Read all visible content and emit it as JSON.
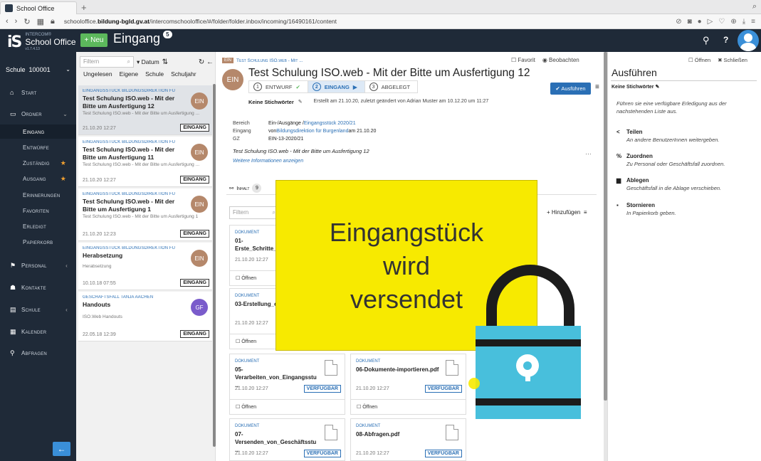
{
  "browser": {
    "tab_title": "School Office",
    "new_tab": "+",
    "url_prefix": "schooloffice.",
    "url_domain": "bildung-bgld.gv.at",
    "url_path": "/intercomschooloffice/#/folder/folder.inbox/incoming/16490161/content"
  },
  "app": {
    "logo_top": "INTERCOM®",
    "logo_name": "School Office",
    "logo_version": "v1.7.4.13",
    "new_button": "+ Neu",
    "title": "Eingang",
    "title_badge": "5",
    "search_icon": "⚲",
    "help": "?"
  },
  "sidebar": {
    "school_label": "Schule",
    "school_number": "100001",
    "items": [
      {
        "icon": "⌂",
        "label": "Start"
      },
      {
        "icon": "▭",
        "label": "Ordner"
      },
      {
        "label": "Eingang"
      },
      {
        "label": "Entwürfe"
      },
      {
        "label": "Zuständig",
        "star": "★"
      },
      {
        "label": "Ausgang",
        "star": "★"
      },
      {
        "label": "Erinnerungen"
      },
      {
        "label": "Favoriten"
      },
      {
        "label": "Erledigt"
      },
      {
        "label": "Papierkorb"
      },
      {
        "icon": "⚑",
        "label": "Personal"
      },
      {
        "icon": "☗",
        "label": "Kontakte"
      },
      {
        "icon": "▤",
        "label": "Schule"
      },
      {
        "icon": "▦",
        "label": "Kalender"
      },
      {
        "icon": "⚲",
        "label": "Abfragen"
      }
    ],
    "back_icon": "←"
  },
  "list": {
    "filter_placeholder": "Filtern",
    "sort": "▾ Datum",
    "filters": [
      "Ungelesen",
      "Eigene",
      "Schule",
      "Schuljahr"
    ],
    "cards": [
      {
        "cat": "Eingangsstück Bildungsdirektion für Bur...",
        "title": "Test Schulung ISO.web - Mit der Bitte um Ausfertigung 12",
        "desc": "Test Schulung ISO.web - Mit der Bitte um Ausfertigung ...",
        "date": "21.10.20 12:27",
        "tag": "EINGANG",
        "avatar": "EIN"
      },
      {
        "cat": "Eingangsstück Bildungsdirektion für Bur...",
        "title": "Test Schulung ISO.web - Mit der Bitte um Ausfertigung 11",
        "desc": "Test Schulung ISO.web - Mit der Bitte um Ausfertigung ...",
        "date": "21.10.20 12:27",
        "tag": "EINGANG",
        "avatar": "EIN"
      },
      {
        "cat": "Eingangsstück Bildungsdirektion für Bur...",
        "title": "Test Schulung ISO.web - Mit der Bitte um Ausfertigung 1",
        "desc": "Test Schulung ISO.web - Mit der Bitte um Ausfertigung 1",
        "date": "21.10.20 12:23",
        "tag": "EINGANG",
        "avatar": "EIN"
      },
      {
        "cat": "Eingangsstück Bildungsdirektion für Bur...",
        "title": "Herabsetzung",
        "desc": "Herabsetzung",
        "date": "10.10.18 07:55",
        "tag": "EINGANG",
        "avatar": "EIN"
      },
      {
        "cat": "Geschäftsfall Tanja Aachen",
        "title": "Handouts",
        "desc": "ISO.Web Handouts",
        "date": "22.05.18 12:39",
        "tag": "EINGANG",
        "avatar": "GF"
      }
    ]
  },
  "detail": {
    "crumb_tag": "EIN",
    "crumb": "Test Schulung ISO.web - Mit ...",
    "favorit": "☐ Favorit",
    "beobachten": "◉ Beobachten",
    "avatar": "EIN",
    "title": "Test Schulung ISO.web - Mit der Bitte um Ausfertigung 12",
    "steps": [
      {
        "n": "1",
        "label": "ENTWURF",
        "mark": "✔"
      },
      {
        "n": "2",
        "label": "EINGANG",
        "mark": "▶"
      },
      {
        "n": "3",
        "label": "ABGELEGT",
        "mark": ""
      }
    ],
    "ausfuehren": "✔ Ausführen",
    "keywords": "Keine Stichwörter",
    "created": "Erstellt am 21.10.20, zuletzt geändert von Adrian Muster am 10.12.20 um 11:27",
    "bereich_k": "Bereich",
    "bereich_v1": "Ein-/Ausgänge / ",
    "bereich_v2": "Eingangsstück 2020/21",
    "eingang_k": "Eingang",
    "eingang_v1": "von ",
    "eingang_v2": "Bildungsdirektion für Burgenland",
    "eingang_v3": " am 21.10.20",
    "gz_k": "GZ",
    "gz_v": "EIN-13-2020/21",
    "subject": "Test Schulung ISO.web - Mit der Bitte um Ausfertigung 12",
    "more": "Weitere Informationen anzeigen",
    "inhalt": "Inhalt",
    "inhalt_count": "9",
    "filter_placeholder": "Filtern",
    "hinzufuegen": "+ Hinzufügen",
    "docs": [
      {
        "label": "DOKUMENT",
        "name": "01-Erste_Schritte_Benutzeroberfla...",
        "date": "21.10.20 12:27",
        "status": "",
        "open": "Öffnen"
      },
      {
        "label": "DOKUMENT",
        "name": "03-Erstellung_eines...",
        "date": "21.10.20 12:27",
        "status": "",
        "open": "Öffnen"
      },
      {
        "label": "DOKUMENT",
        "name": "05-Verarbeiten_von_Eingangsstu ...",
        "date": "21.10.20 12:27",
        "status": "VERFÜGBAR",
        "open": "Öffnen"
      },
      {
        "label": "DOKUMENT",
        "name": "06-Dokumente-importieren.pdf",
        "date": "21.10.20 12:27",
        "status": "VERFÜGBAR",
        "open": "Öffnen"
      },
      {
        "label": "DOKUMENT",
        "name": "07-Versenden_von_Geschäftsstu ...",
        "date": "21.10.20 12:27",
        "status": "VERFÜGBAR",
        "open": ""
      },
      {
        "label": "DOKUMENT",
        "name": "08-Abfragen.pdf",
        "date": "21.10.20 12:27",
        "status": "VERFÜGBAR",
        "open": ""
      }
    ]
  },
  "right": {
    "open": "☐ Öffnen",
    "close": "✖ Schließen",
    "title": "Ausführen",
    "keywords": "Keine Stichwörter",
    "hint": "Führen sie eine verfügbare Erledigung aus der nachstehenden Liste aus.",
    "actions": [
      {
        "icon": "<",
        "name": "Teilen",
        "desc": "An andere BenutzerInnen weitergeben."
      },
      {
        "icon": "%",
        "name": "Zuordnen",
        "desc": "Zu Personal oder Geschäftsfall zuordnen."
      },
      {
        "icon": "▆",
        "name": "Ablegen",
        "desc": "Geschäftsfall in die Ablage verschieben."
      },
      {
        "icon": "▪",
        "name": "Stornieren",
        "desc": "In Papierkorb geben."
      }
    ]
  },
  "overlay": {
    "line1": "Eingangstück",
    "line2": "wird",
    "line3": "versendet",
    "yellow": "#f7ea00",
    "lock_color": "#48bfdc"
  }
}
